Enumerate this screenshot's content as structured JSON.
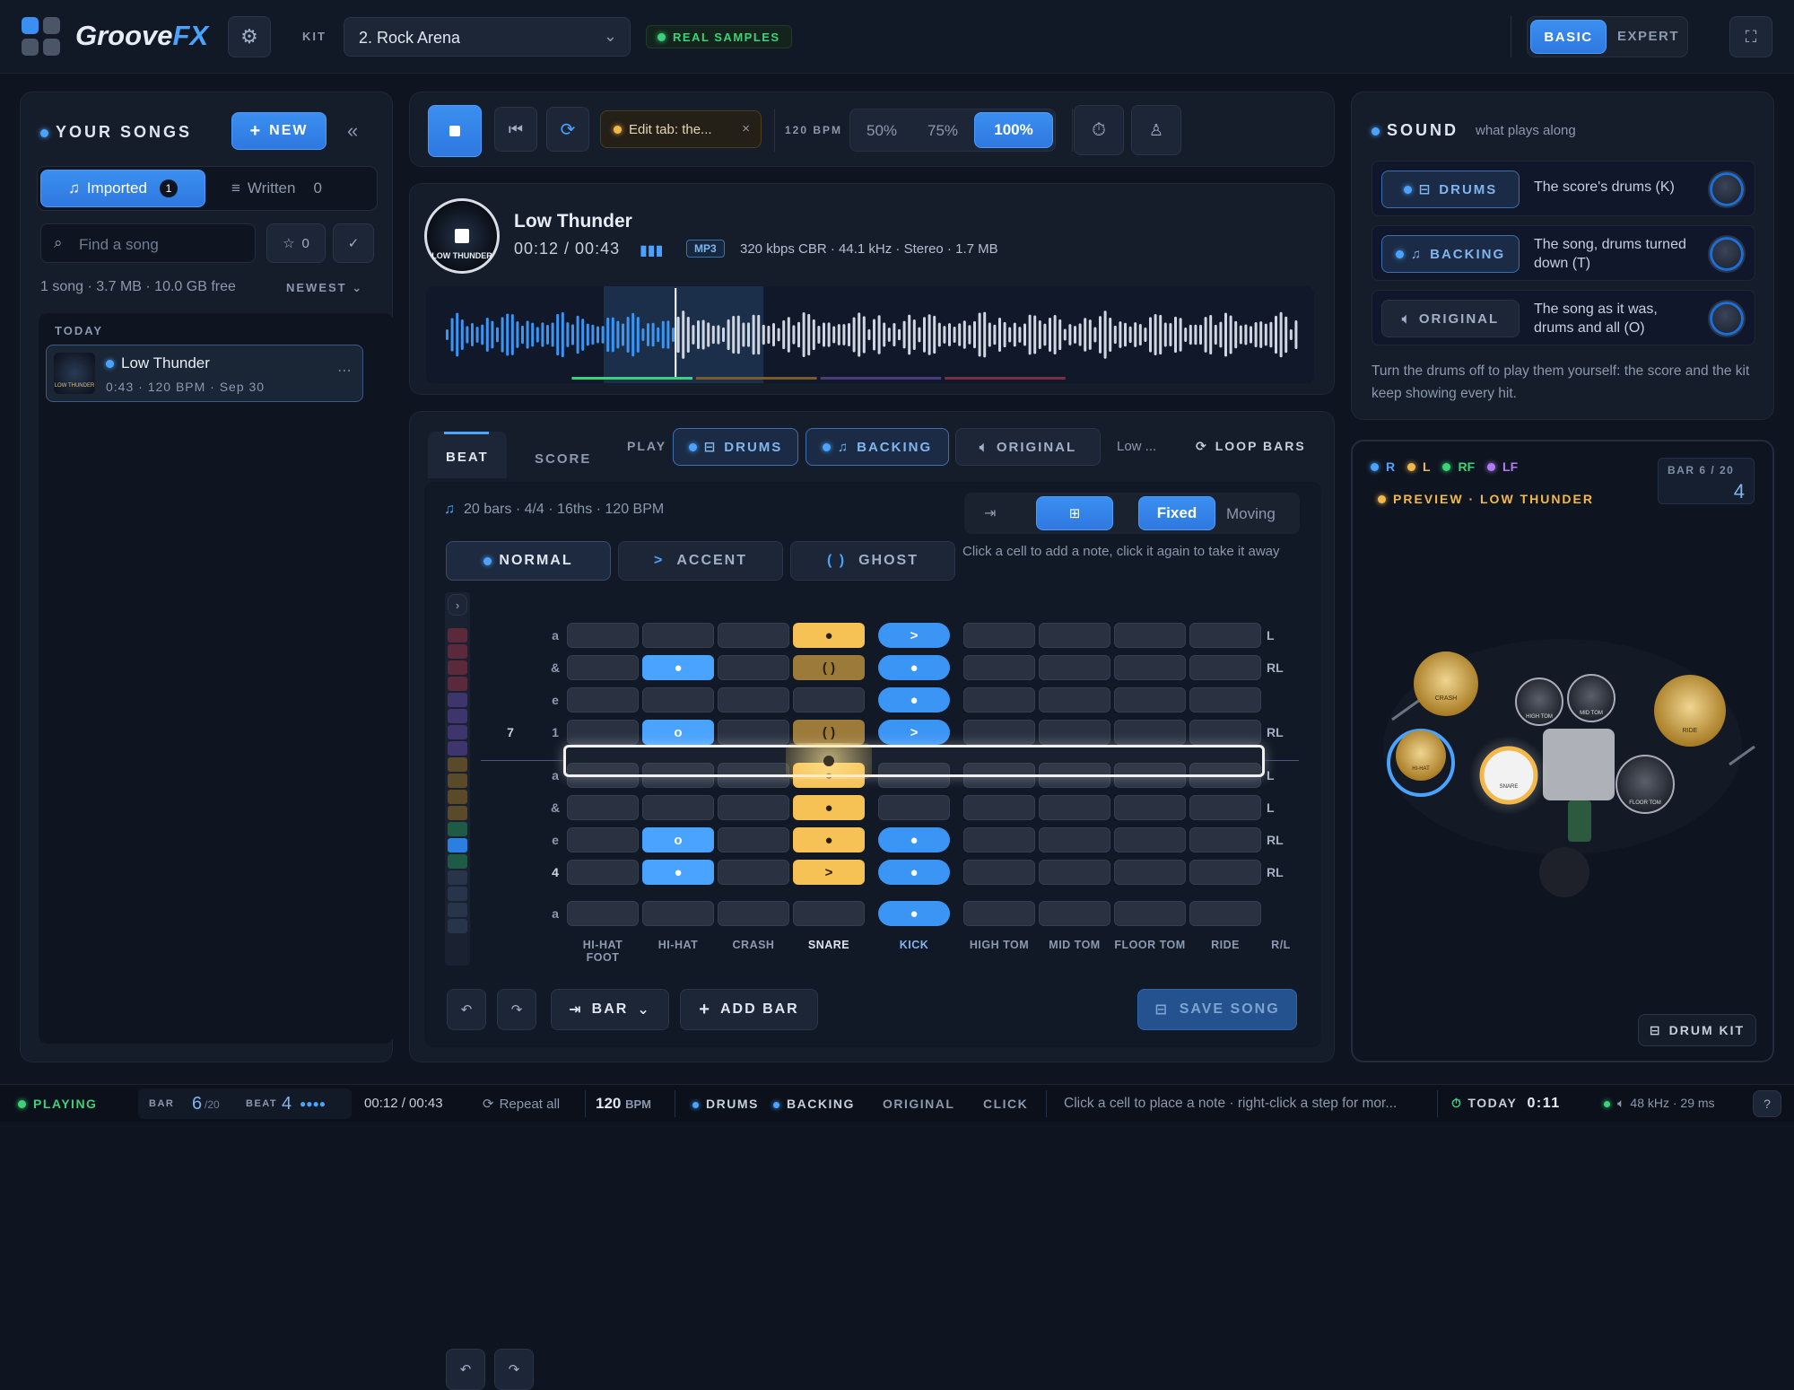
{
  "app": {
    "name_a": "Groove",
    "name_b": "FX",
    "kit_label": "KIT",
    "kit_value": "2. Rock Arena",
    "real_samples": "REAL SAMPLES",
    "mode_basic": "BASIC",
    "mode_expert": "EXPERT"
  },
  "songs": {
    "title": "YOUR SONGS",
    "new_label": "NEW",
    "tab_imported": "Imported",
    "tab_imported_count": "1",
    "tab_written": "Written",
    "tab_written_count": "0",
    "search_placeholder": "Find a song",
    "star_count": "0",
    "summary": "1 song · 3.7 MB · 10.0 GB free",
    "sort": "NEWEST",
    "group": "TODAY",
    "item_title": "Low Thunder",
    "item_meta": "0:43 · 120 BPM · Sep 30",
    "item_art": "LOW THUNDER"
  },
  "transport": {
    "edit_tab": "Edit tab: the...",
    "bpm": "120 BPM",
    "speed_50": "50%",
    "speed_75": "75%",
    "speed_100": "100%"
  },
  "track": {
    "title": "Low Thunder",
    "time": "00:12 / 00:43",
    "format": "MP3",
    "specs": "320 kbps CBR · 44.1 kHz · Stereo · 1.7 MB",
    "art": "LOW THUNDER",
    "progress": 0.28
  },
  "editor": {
    "tab_beat": "BEAT",
    "tab_score": "SCORE",
    "play": "PLAY",
    "drums": "DRUMS",
    "backing": "BACKING",
    "original": "ORIGINAL",
    "low": "Low ...",
    "loop": "LOOP BARS",
    "info": "20 bars · 4/4 · 16ths · 120 BPM",
    "fixed": "Fixed",
    "moving": "Moving",
    "normal": "NORMAL",
    "accent": "ACCENT",
    "accent_sym": ">",
    "ghost": "GHOST",
    "ghost_sym": "( )",
    "hint": "Click a cell to add a note, click it again to take it away",
    "bar_num": "7",
    "beat_num": "4",
    "rows": [
      "a",
      "&",
      "e",
      "1",
      "a",
      "&",
      "e",
      "4",
      "a"
    ],
    "rl": [
      "L",
      "RL",
      "",
      "RL",
      "L",
      "L",
      "RL",
      "RL",
      ""
    ],
    "columns": [
      "HI-HAT FOOT",
      "HI-HAT",
      "CRASH",
      "SNARE",
      "KICK",
      "HIGH TOM",
      "MID TOM",
      "FLOOR TOM",
      "RIDE",
      "R/L"
    ],
    "undo_bar": "BAR",
    "add_bar": "ADD BAR",
    "save": "SAVE SONG",
    "marks": {
      "normal": "●",
      "ghost_hh": "o",
      "accent": ">",
      "ghost": "( )"
    }
  },
  "sound": {
    "title": "SOUND",
    "subtitle": "what plays along",
    "drums": "DRUMS",
    "drums_desc": "The score's drums (K)",
    "backing": "BACKING",
    "backing_desc": "The song, drums turned down (T)",
    "original": "ORIGINAL",
    "original_desc": "The song as it was, drums and all (O)",
    "note": "Turn the drums off to play them yourself: the score and the kit keep showing every hit."
  },
  "preview": {
    "legend_r": "R",
    "legend_l": "L",
    "legend_rf": "RF",
    "legend_lf": "LF",
    "label": "PREVIEW · LOW THUNDER",
    "bar_label": "BAR 6 / 20",
    "bar_beat": "4",
    "kit_btn": "DRUM KIT",
    "crash": "CRASH",
    "ride": "RIDE",
    "hihat": "HI-HAT",
    "snare": "SNARE",
    "hightom": "HIGH TOM",
    "midtom": "MID TOM",
    "floortom": "FLOOR TOM"
  },
  "status": {
    "playing": "PLAYING",
    "bar": "BAR",
    "bar_val": "6",
    "bar_total": "/20",
    "beat": "BEAT",
    "beat_val": "4",
    "time": "00:12 / 00:43",
    "repeat": "Repeat all",
    "bpm": "120",
    "bpm_unit": "BPM",
    "drums": "DRUMS",
    "backing": "BACKING",
    "original": "ORIGINAL",
    "click": "CLICK",
    "hint": "Click a cell to place a note · right-click a step for mor...",
    "today": "TODAY",
    "clock": "0:11",
    "audio": "48 kHz · 29 ms",
    "help": "?"
  }
}
